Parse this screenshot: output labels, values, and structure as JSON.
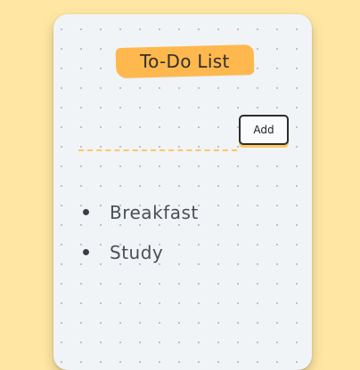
{
  "app": {
    "title": "To-Do List",
    "add_button_label": "Add",
    "todos": [
      {
        "label": "Breakfast"
      },
      {
        "label": "Study"
      }
    ]
  },
  "colors": {
    "background": "#FFE7A3",
    "card": "#F1F4F7",
    "accent": "#FFB84D",
    "accent_soft": "#FFC766",
    "text": "#2F2F2F"
  }
}
